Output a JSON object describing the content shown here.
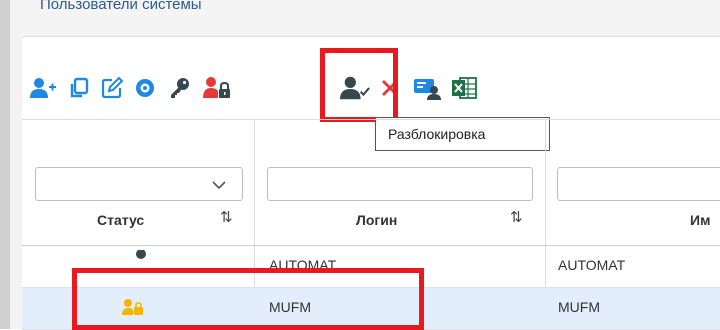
{
  "panel": {
    "title": "Пользователи системы"
  },
  "toolbar": {
    "buttons": [
      {
        "icon": "add-user-icon",
        "color": "#1e88e5"
      },
      {
        "icon": "copy-icon",
        "color": "#1e88e5"
      },
      {
        "icon": "edit-icon",
        "color": "#1e88e5"
      },
      {
        "icon": "view-icon",
        "color": "#1e88e5"
      },
      {
        "icon": "key-icon",
        "color": "#37474f"
      },
      {
        "icon": "lock-user-icon",
        "color": "#e53935"
      },
      {
        "icon": "unlock-user-icon",
        "color": "#37474f"
      },
      {
        "icon": "delete-icon",
        "color": "#e53935"
      },
      {
        "icon": "user-card-icon",
        "color": "#1e88e5"
      },
      {
        "icon": "excel-icon",
        "color": "#1d7145"
      }
    ],
    "tooltip": "Разблокировка"
  },
  "grid": {
    "columns": [
      {
        "label": "Статус",
        "sort": "⇅"
      },
      {
        "label": "Логин",
        "sort": "⇅"
      },
      {
        "label": "Им"
      }
    ],
    "rows": [
      {
        "status_icon": "key-icon",
        "login": "AUTOMAT",
        "name": "AUTOMAT",
        "selected": false
      },
      {
        "status_icon": "locked-user-icon",
        "login": "MUFM",
        "name": "MUFM",
        "selected": true
      }
    ]
  },
  "colors": {
    "highlight": "#e8191f",
    "selected_row": "#e2eefb",
    "accent": "#1e88e5"
  }
}
